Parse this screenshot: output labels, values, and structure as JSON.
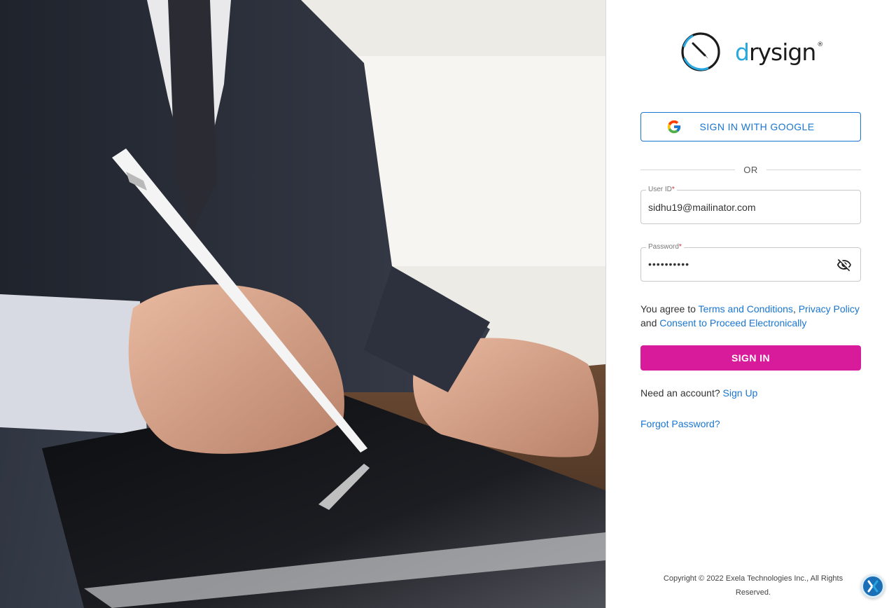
{
  "hero": {
    "icon": "hand-signing-tablet-image"
  },
  "brand": {
    "name_prefix": "d",
    "name_rest": "rysign",
    "registered": "®",
    "accent_color": "#29a8e0"
  },
  "google_signin": {
    "label": "SIGN IN WITH GOOGLE",
    "icon": "google-icon"
  },
  "divider_text": "OR",
  "user_id": {
    "label": "User ID",
    "required_mark": "*",
    "value": "sidhu19@mailinator.com"
  },
  "password": {
    "label": "Password",
    "required_mark": "*",
    "value": "••••••••••",
    "toggle_icon": "eye-off-icon"
  },
  "agreement": {
    "prefix": "You agree to ",
    "terms": "Terms and Conditions",
    "sep": ", ",
    "privacy": "Privacy Policy",
    "and": " and ",
    "consent": "Consent to Proceed Electronically"
  },
  "signin_button": {
    "label": "SIGN IN",
    "color": "#d81b9a"
  },
  "signup": {
    "prompt": "Need an account? ",
    "link": "Sign Up"
  },
  "forgot_password": "Forgot Password?",
  "footer": {
    "copyright": "Copyright © 2022 Exela Technologies Inc., All Rights Reserved."
  },
  "help": {
    "icon": "exela-chat-icon"
  },
  "colors": {
    "link": "#1976d2",
    "border": "#c9c9c9"
  }
}
